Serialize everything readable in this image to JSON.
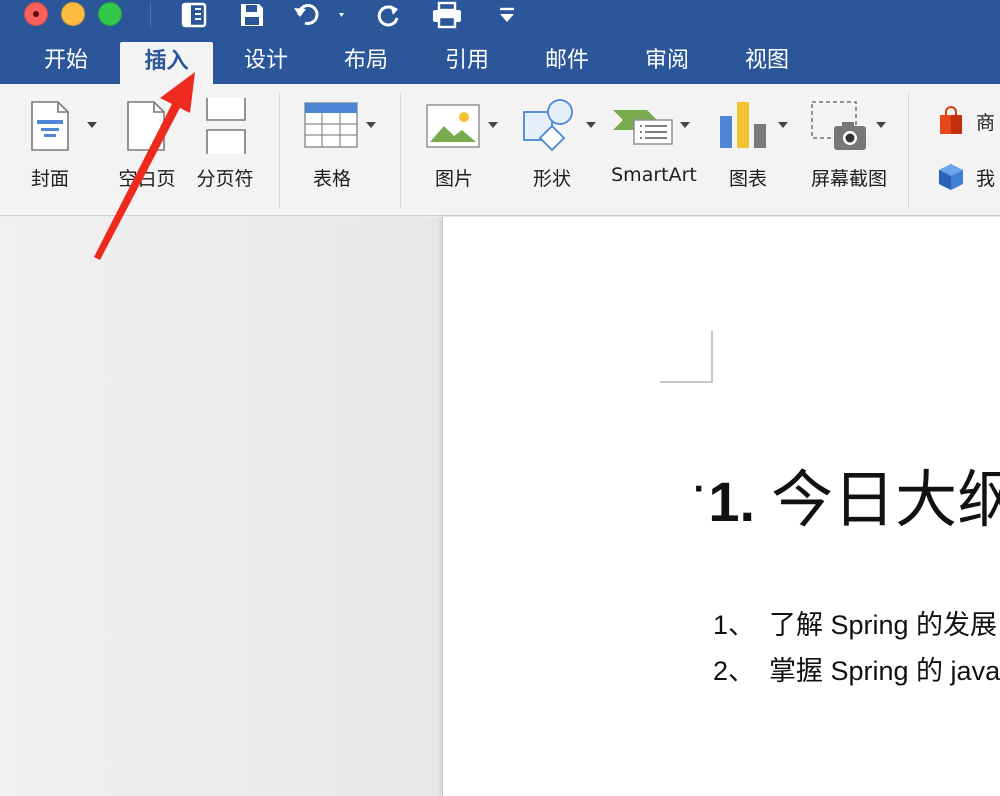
{
  "colors": {
    "brand": "#2b579a",
    "ribbon": "#f3f3f3",
    "arrow": "#ee2a1f"
  },
  "quick_access": [
    "sidebar-toggle-icon",
    "save-icon",
    "undo-icon",
    "redo-icon",
    "print-icon",
    "customize-toolbar-icon"
  ],
  "tabs": [
    "开始",
    "插入",
    "设计",
    "布局",
    "引用",
    "邮件",
    "审阅",
    "视图"
  ],
  "active_tab": "插入",
  "ribbon": {
    "cover": "封面",
    "blank_page": "空白页",
    "page_break": "分页符",
    "table": "表格",
    "picture": "图片",
    "shapes": "形状",
    "smartart": "SmartArt",
    "chart": "图表",
    "screenshot": "屏幕截图",
    "store": "商",
    "my_addins": "我"
  },
  "document": {
    "heading_number": "1.",
    "heading_text": "今日大纲",
    "items": [
      {
        "num": "1、",
        "text": "了解 Spring 的发展"
      },
      {
        "num": "2、",
        "text": "掌握 Spring 的 java"
      }
    ]
  }
}
